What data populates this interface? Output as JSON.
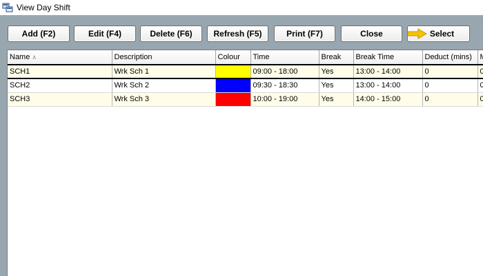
{
  "window": {
    "title": "View Day Shift",
    "icon": "app-window-icon"
  },
  "toolbar": {
    "buttons": [
      {
        "label": "Add (F2)"
      },
      {
        "label": "Edit (F4)"
      },
      {
        "label": "Delete (F6)"
      },
      {
        "label": "Refresh (F5)"
      },
      {
        "label": "Print (F7)"
      },
      {
        "label": "Close"
      },
      {
        "label": "Select",
        "icon": "arrow-right-icon",
        "icon_color": "#f5c400"
      }
    ]
  },
  "grid": {
    "sort_indicator": "∧",
    "columns": [
      "Name",
      "Description",
      "Colour",
      "Time",
      "Break",
      "Break Time",
      "Deduct (mins)",
      "M"
    ],
    "rows": [
      {
        "name": "SCH1",
        "description": "Wrk Sch 1",
        "colour": "#ffff00",
        "time": "09:00 - 18:00",
        "break": "Yes",
        "break_time": "13:00 - 14:00",
        "deduct": "0",
        "m": "0"
      },
      {
        "name": "SCH2",
        "description": "Wrk Sch 2",
        "colour": "#0000ff",
        "time": "09:30 - 18:30",
        "break": "Yes",
        "break_time": "13:00 - 14:00",
        "deduct": "0",
        "m": "0"
      },
      {
        "name": "SCH3",
        "description": "Wrk Sch 3",
        "colour": "#ff0000",
        "time": "10:00 - 19:00",
        "break": "Yes",
        "break_time": "14:00 - 15:00",
        "deduct": "0",
        "m": "0"
      }
    ],
    "selected_row": 0
  }
}
